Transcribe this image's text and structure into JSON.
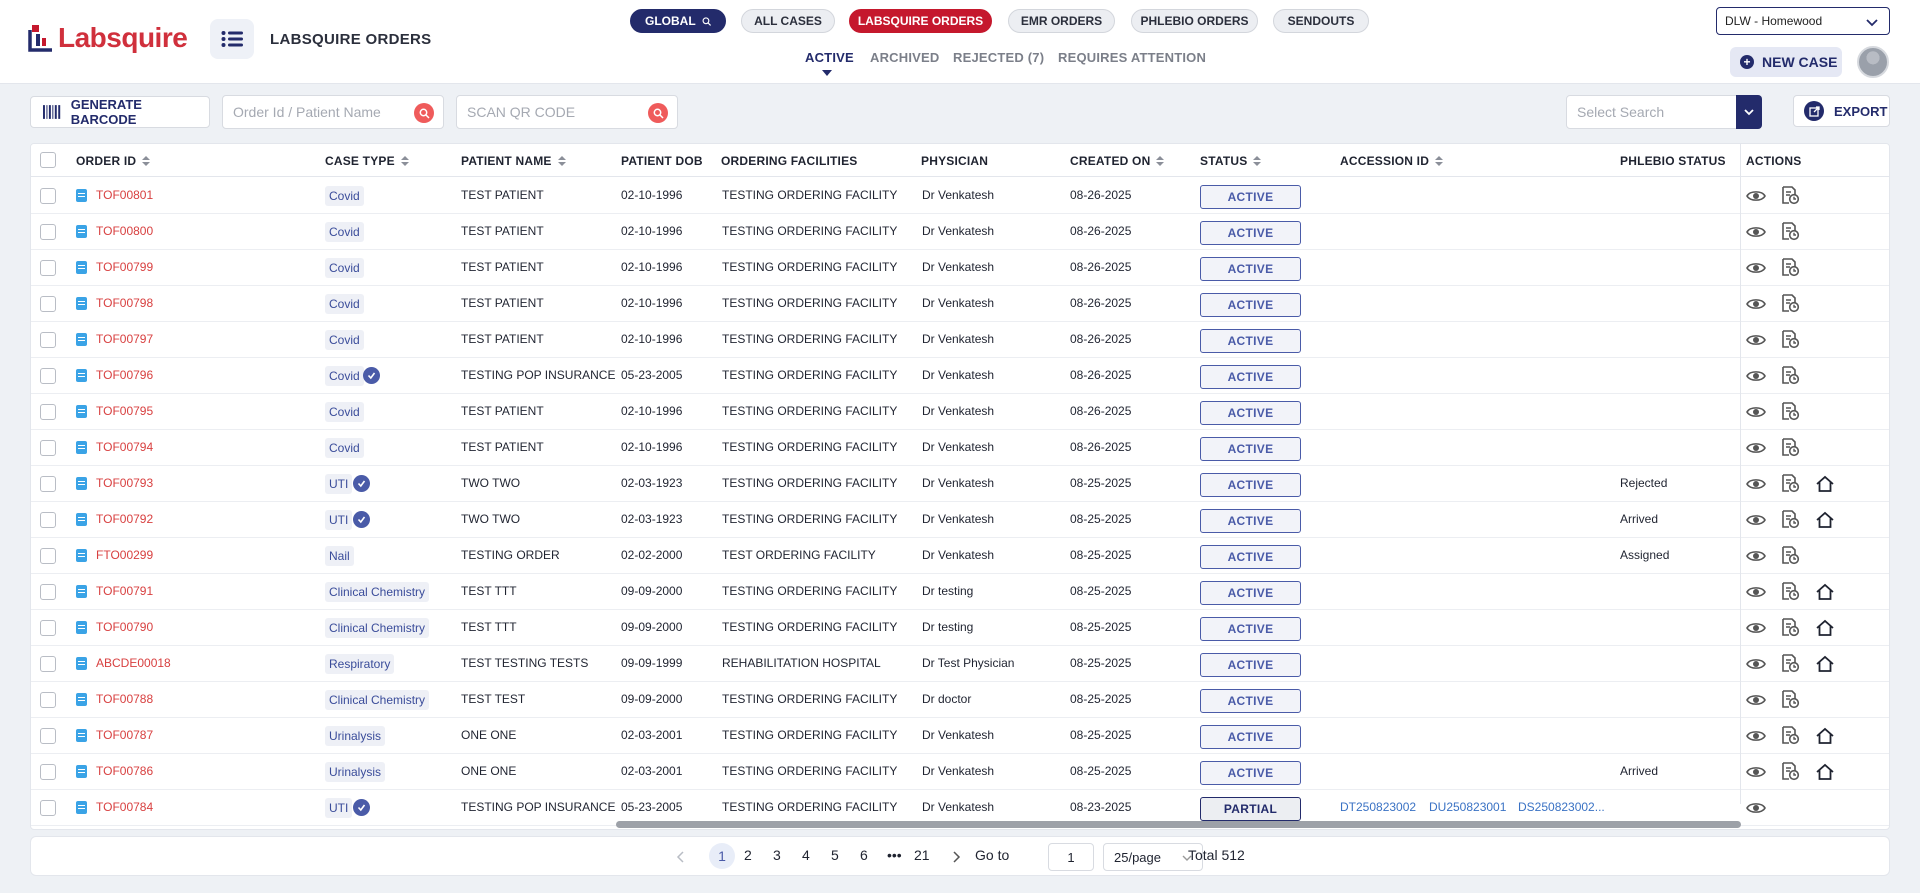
{
  "header": {
    "logo_text": "Labsquire",
    "page_title": "LABSQUIRE ORDERS",
    "top_tabs": [
      "GLOBAL",
      "ALL CASES",
      "LABSQUIRE ORDERS",
      "EMR ORDERS",
      "PHLEBIO ORDERS",
      "SENDOUTS"
    ],
    "active_top_tab": "LABSQUIRE ORDERS",
    "sub_tabs": [
      "ACTIVE",
      "ARCHIVED",
      "REJECTED (7)",
      "REQUIRES ATTENTION"
    ],
    "active_sub_tab": "ACTIVE",
    "location": "DLW - Homewood",
    "new_case_label": "NEW CASE"
  },
  "toolbar": {
    "generate_barcode_label": "GENERATE BARCODE",
    "order_search_placeholder": "Order Id / Patient Name",
    "scan_placeholder": "SCAN QR CODE",
    "select_search_placeholder": "Select Search",
    "export_label": "EXPORT"
  },
  "table": {
    "columns": [
      "ORDER ID",
      "CASE TYPE",
      "PATIENT NAME",
      "PATIENT DOB",
      "ORDERING FACILITIES",
      "PHYSICIAN",
      "CREATED ON",
      "STATUS",
      "ACCESSION ID",
      "PHLEBIO STATUS",
      "ACTIONS"
    ],
    "rows": [
      {
        "order_id": "TOF00801",
        "case_type": "Covid",
        "verified": false,
        "patient": "TEST PATIENT",
        "dob": "02-10-1996",
        "facility": "TESTING ORDERING FACILITY",
        "physician": "Dr Venkatesh",
        "created": "08-26-2025",
        "status": "ACTIVE",
        "accession": [],
        "phlebio": "",
        "home": false
      },
      {
        "order_id": "TOF00800",
        "case_type": "Covid",
        "verified": false,
        "patient": "TEST PATIENT",
        "dob": "02-10-1996",
        "facility": "TESTING ORDERING FACILITY",
        "physician": "Dr Venkatesh",
        "created": "08-26-2025",
        "status": "ACTIVE",
        "accession": [],
        "phlebio": "",
        "home": false
      },
      {
        "order_id": "TOF00799",
        "case_type": "Covid",
        "verified": false,
        "patient": "TEST PATIENT",
        "dob": "02-10-1996",
        "facility": "TESTING ORDERING FACILITY",
        "physician": "Dr Venkatesh",
        "created": "08-26-2025",
        "status": "ACTIVE",
        "accession": [],
        "phlebio": "",
        "home": false
      },
      {
        "order_id": "TOF00798",
        "case_type": "Covid",
        "verified": false,
        "patient": "TEST PATIENT",
        "dob": "02-10-1996",
        "facility": "TESTING ORDERING FACILITY",
        "physician": "Dr Venkatesh",
        "created": "08-26-2025",
        "status": "ACTIVE",
        "accession": [],
        "phlebio": "",
        "home": false
      },
      {
        "order_id": "TOF00797",
        "case_type": "Covid",
        "verified": false,
        "patient": "TEST PATIENT",
        "dob": "02-10-1996",
        "facility": "TESTING ORDERING FACILITY",
        "physician": "Dr Venkatesh",
        "created": "08-26-2025",
        "status": "ACTIVE",
        "accession": [],
        "phlebio": "",
        "home": false
      },
      {
        "order_id": "TOF00796",
        "case_type": "Covid",
        "verified": true,
        "patient": "TESTING POP INSURANCE",
        "dob": "05-23-2005",
        "facility": "TESTING ORDERING FACILITY",
        "physician": "Dr Venkatesh",
        "created": "08-26-2025",
        "status": "ACTIVE",
        "accession": [],
        "phlebio": "",
        "home": false
      },
      {
        "order_id": "TOF00795",
        "case_type": "Covid",
        "verified": false,
        "patient": "TEST PATIENT",
        "dob": "02-10-1996",
        "facility": "TESTING ORDERING FACILITY",
        "physician": "Dr Venkatesh",
        "created": "08-26-2025",
        "status": "ACTIVE",
        "accession": [],
        "phlebio": "",
        "home": false
      },
      {
        "order_id": "TOF00794",
        "case_type": "Covid",
        "verified": false,
        "patient": "TEST PATIENT",
        "dob": "02-10-1996",
        "facility": "TESTING ORDERING FACILITY",
        "physician": "Dr Venkatesh",
        "created": "08-26-2025",
        "status": "ACTIVE",
        "accession": [],
        "phlebio": "",
        "home": false
      },
      {
        "order_id": "TOF00793",
        "case_type": "UTI",
        "verified": true,
        "patient": "TWO TWO",
        "dob": "02-03-1923",
        "facility": "TESTING ORDERING FACILITY",
        "physician": "Dr Venkatesh",
        "created": "08-25-2025",
        "status": "ACTIVE",
        "accession": [],
        "phlebio": "Rejected",
        "home": true
      },
      {
        "order_id": "TOF00792",
        "case_type": "UTI",
        "verified": true,
        "patient": "TWO TWO",
        "dob": "02-03-1923",
        "facility": "TESTING ORDERING FACILITY",
        "physician": "Dr Venkatesh",
        "created": "08-25-2025",
        "status": "ACTIVE",
        "accession": [],
        "phlebio": "Arrived",
        "home": true
      },
      {
        "order_id": "FTO00299",
        "case_type": "Nail",
        "verified": false,
        "patient": "TESTING ORDER",
        "dob": "02-02-2000",
        "facility": "TEST ORDERING FACILITY",
        "physician": "Dr Venkatesh",
        "created": "08-25-2025",
        "status": "ACTIVE",
        "accession": [],
        "phlebio": "Assigned",
        "home": false
      },
      {
        "order_id": "TOF00791",
        "case_type": "Clinical Chemistry",
        "verified": false,
        "patient": "TEST TTT",
        "dob": "09-09-2000",
        "facility": "TESTING ORDERING FACILITY",
        "physician": "Dr testing",
        "created": "08-25-2025",
        "status": "ACTIVE",
        "accession": [],
        "phlebio": "",
        "home": true
      },
      {
        "order_id": "TOF00790",
        "case_type": "Clinical Chemistry",
        "verified": false,
        "patient": "TEST TTT",
        "dob": "09-09-2000",
        "facility": "TESTING ORDERING FACILITY",
        "physician": "Dr testing",
        "created": "08-25-2025",
        "status": "ACTIVE",
        "accession": [],
        "phlebio": "",
        "home": true
      },
      {
        "order_id": "ABCDE00018",
        "case_type": "Respiratory",
        "verified": false,
        "patient": "TEST TESTING TESTS",
        "dob": "09-09-1999",
        "facility": "REHABILITATION HOSPITAL",
        "physician": "Dr Test Physician",
        "created": "08-25-2025",
        "status": "ACTIVE",
        "accession": [],
        "phlebio": "",
        "home": true
      },
      {
        "order_id": "TOF00788",
        "case_type": "Clinical Chemistry",
        "verified": false,
        "patient": "TEST TEST",
        "dob": "09-09-2000",
        "facility": "TESTING ORDERING FACILITY",
        "physician": "Dr doctor",
        "created": "08-25-2025",
        "status": "ACTIVE",
        "accession": [],
        "phlebio": "",
        "home": false
      },
      {
        "order_id": "TOF00787",
        "case_type": "Urinalysis",
        "verified": false,
        "patient": "ONE ONE",
        "dob": "02-03-2001",
        "facility": "TESTING ORDERING FACILITY",
        "physician": "Dr Venkatesh",
        "created": "08-25-2025",
        "status": "ACTIVE",
        "accession": [],
        "phlebio": "",
        "home": true
      },
      {
        "order_id": "TOF00786",
        "case_type": "Urinalysis",
        "verified": false,
        "patient": "ONE ONE",
        "dob": "02-03-2001",
        "facility": "TESTING ORDERING FACILITY",
        "physician": "Dr Venkatesh",
        "created": "08-25-2025",
        "status": "ACTIVE",
        "accession": [],
        "phlebio": "Arrived",
        "home": true
      },
      {
        "order_id": "TOF00784",
        "case_type": "UTI",
        "verified": true,
        "patient": "TESTING POP INSURANCE",
        "dob": "05-23-2005",
        "facility": "TESTING ORDERING FACILITY",
        "physician": "Dr Venkatesh",
        "created": "08-23-2025",
        "status": "PARTIAL",
        "accession": [
          "DT250823002",
          "DU250823001",
          "DS250823002..."
        ],
        "phlebio": "",
        "home": false
      }
    ]
  },
  "pagination": {
    "pages": [
      "1",
      "2",
      "3",
      "4",
      "5",
      "6",
      "•••",
      "21"
    ],
    "current": "1",
    "goto_label": "Go to",
    "goto_value": "1",
    "per_page": "25/page",
    "total": "Total 512"
  },
  "colors": {
    "brand_navy": "#232b6b",
    "brand_red": "#c5182d",
    "order_id": "#d84040",
    "status_blue": "#4a5ba8"
  }
}
